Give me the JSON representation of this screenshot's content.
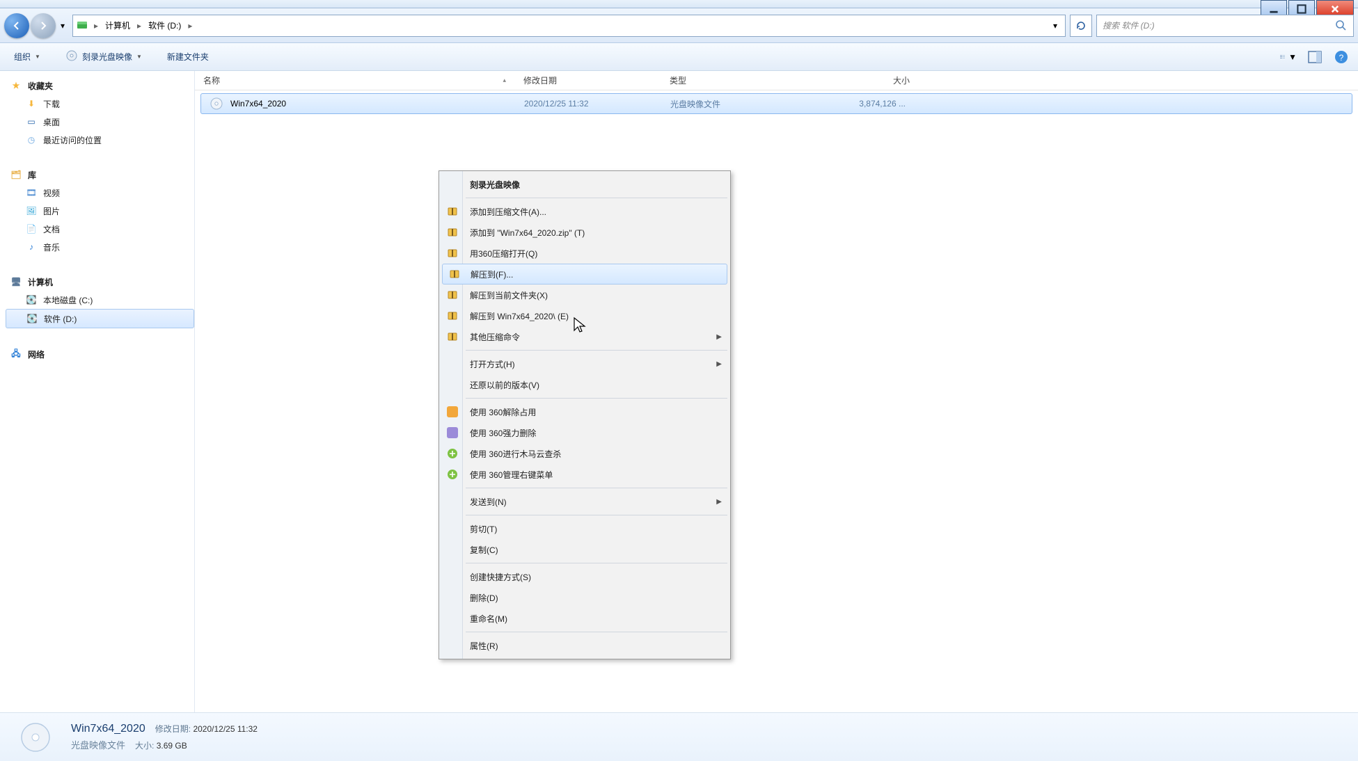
{
  "titlebar": {},
  "nav": {
    "path": [
      {
        "label": "计算机"
      },
      {
        "label": "软件 (D:)"
      }
    ]
  },
  "search": {
    "placeholder": "搜索 软件 (D:)"
  },
  "toolbar": {
    "organize": "组织",
    "burn": "刻录光盘映像",
    "newfolder": "新建文件夹"
  },
  "sidebar": {
    "favorites": {
      "header": "收藏夹",
      "items": [
        {
          "label": "下载"
        },
        {
          "label": "桌面"
        },
        {
          "label": "最近访问的位置"
        }
      ]
    },
    "libraries": {
      "header": "库",
      "items": [
        {
          "label": "视频"
        },
        {
          "label": "图片"
        },
        {
          "label": "文档"
        },
        {
          "label": "音乐"
        }
      ]
    },
    "computer": {
      "header": "计算机",
      "items": [
        {
          "label": "本地磁盘 (C:)"
        },
        {
          "label": "软件 (D:)",
          "selected": true
        }
      ]
    },
    "network": {
      "header": "网络"
    }
  },
  "columns": {
    "name": "名称",
    "date": "修改日期",
    "type": "类型",
    "size": "大小"
  },
  "files": [
    {
      "name": "Win7x64_2020",
      "date": "2020/12/25 11:32",
      "type": "光盘映像文件",
      "size": "3,874,126 ..."
    }
  ],
  "context": {
    "items": [
      {
        "label": "刻录光盘映像",
        "bold": true
      },
      {
        "sep": true
      },
      {
        "label": "添加到压缩文件(A)...",
        "icon": "zip"
      },
      {
        "label": "添加到 \"Win7x64_2020.zip\" (T)",
        "icon": "zip"
      },
      {
        "label": "用360压缩打开(Q)",
        "icon": "zip"
      },
      {
        "label": "解压到(F)...",
        "icon": "zip",
        "hover": true
      },
      {
        "label": "解压到当前文件夹(X)",
        "icon": "zip"
      },
      {
        "label": "解压到 Win7x64_2020\\ (E)",
        "icon": "zip"
      },
      {
        "label": "其他压缩命令",
        "icon": "zip",
        "submenu": true
      },
      {
        "sep": true
      },
      {
        "label": "打开方式(H)",
        "submenu": true
      },
      {
        "label": "还原以前的版本(V)"
      },
      {
        "sep": true
      },
      {
        "label": "使用 360解除占用",
        "icon": "360o"
      },
      {
        "label": "使用 360强力删除",
        "icon": "360p"
      },
      {
        "label": "使用 360进行木马云查杀",
        "icon": "360g"
      },
      {
        "label": "使用 360管理右键菜单",
        "icon": "360g"
      },
      {
        "sep": true
      },
      {
        "label": "发送到(N)",
        "submenu": true
      },
      {
        "sep": true
      },
      {
        "label": "剪切(T)"
      },
      {
        "label": "复制(C)"
      },
      {
        "sep": true
      },
      {
        "label": "创建快捷方式(S)"
      },
      {
        "label": "删除(D)"
      },
      {
        "label": "重命名(M)"
      },
      {
        "sep": true
      },
      {
        "label": "属性(R)"
      }
    ]
  },
  "details": {
    "filename": "Win7x64_2020",
    "filetype": "光盘映像文件",
    "date_label": "修改日期:",
    "date_value": "2020/12/25 11:32",
    "size_label": "大小:",
    "size_value": "3.69 GB"
  }
}
